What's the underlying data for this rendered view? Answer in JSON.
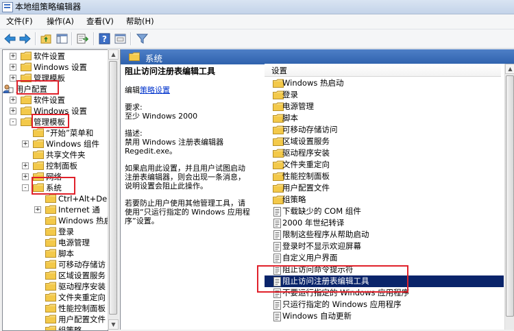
{
  "window": {
    "title": "本地组策略编辑器"
  },
  "menu": [
    {
      "label": "文件(F)"
    },
    {
      "label": "操作(A)"
    },
    {
      "label": "查看(V)"
    },
    {
      "label": "帮助(H)"
    }
  ],
  "toolbar": {
    "icons": [
      "back-arrow-icon",
      "forward-arrow-icon",
      "up-folder-icon",
      "show-hide-tree-icon",
      "export-list-icon",
      "help-icon",
      "properties-icon",
      "filter-icon"
    ]
  },
  "tree": {
    "items": [
      {
        "label": "软件设置",
        "expander": "+"
      },
      {
        "label": "Windows 设置",
        "expander": "+"
      },
      {
        "label": "管理模板",
        "expander": "+"
      },
      {
        "label": "用户配置",
        "expander": ""
      },
      {
        "label": "软件设置",
        "expander": "+"
      },
      {
        "label": "Windows 设置",
        "expander": "+"
      },
      {
        "label": "管理模板",
        "expander": "-"
      },
      {
        "label": "“开始”菜单和",
        "expander": ""
      },
      {
        "label": "Windows 组件",
        "expander": "+"
      },
      {
        "label": "共享文件夹",
        "expander": ""
      },
      {
        "label": "控制面板",
        "expander": "+"
      },
      {
        "label": "网络",
        "expander": "+"
      },
      {
        "label": "系统",
        "expander": "-"
      },
      {
        "label": "Ctrl+Alt+De",
        "expander": ""
      },
      {
        "label": "Internet 通",
        "expander": "+"
      },
      {
        "label": "Windows 热启",
        "expander": ""
      },
      {
        "label": "登录",
        "expander": ""
      },
      {
        "label": "电源管理",
        "expander": ""
      },
      {
        "label": "脚本",
        "expander": ""
      },
      {
        "label": "可移动存储访",
        "expander": ""
      },
      {
        "label": "区域设置服务",
        "expander": ""
      },
      {
        "label": "驱动程序安装",
        "expander": ""
      },
      {
        "label": "文件夹重定向",
        "expander": ""
      },
      {
        "label": "性能控制面板",
        "expander": ""
      },
      {
        "label": "用户配置文件",
        "expander": ""
      },
      {
        "label": "组策略",
        "expander": ""
      }
    ]
  },
  "right": {
    "header": "系统",
    "desc": {
      "title": "阻止访问注册表编辑工具",
      "edit_prefix": "编辑",
      "edit_link": "策略设置",
      "req_label": "要求:",
      "req_value": "至少 Windows 2000",
      "desc_label": "描述:",
      "desc_line1": "禁用 Windows 注册表编辑器",
      "desc_line2": "Regedit.exe。",
      "para1_l1": "如果启用此设置，并且用户试图启动",
      "para1_l2": "注册表编辑器，则会出现一条消息，",
      "para1_l3": "说明设置会阻止此操作。",
      "para2_l1": "若要防止用户使用其他管理工具，请",
      "para2_l2": "使用“只运行指定的 Windows 应用程",
      "para2_l3": "序”设置。"
    },
    "list_header": "设置",
    "list": [
      {
        "label": "Windows 热启动",
        "type": "folder"
      },
      {
        "label": "登录",
        "type": "folder"
      },
      {
        "label": "电源管理",
        "type": "folder"
      },
      {
        "label": "脚本",
        "type": "folder"
      },
      {
        "label": "可移动存储访问",
        "type": "folder"
      },
      {
        "label": "区域设置服务",
        "type": "folder"
      },
      {
        "label": "驱动程序安装",
        "type": "folder"
      },
      {
        "label": "文件夹重定向",
        "type": "folder"
      },
      {
        "label": "性能控制面板",
        "type": "folder"
      },
      {
        "label": "用户配置文件",
        "type": "folder"
      },
      {
        "label": "组策略",
        "type": "folder"
      },
      {
        "label": "下载缺少的 COM 组件",
        "type": "setting"
      },
      {
        "label": "2000 年世纪转译",
        "type": "setting"
      },
      {
        "label": "限制这些程序从帮助启动",
        "type": "setting"
      },
      {
        "label": "登录时不显示欢迎屏幕",
        "type": "setting"
      },
      {
        "label": "自定义用户界面",
        "type": "setting"
      },
      {
        "label": "阻止访问命令提示符",
        "type": "setting"
      },
      {
        "label": "阻止访问注册表编辑工具",
        "type": "setting",
        "selected": true
      },
      {
        "label": "不要运行指定的 Windows 应用程序",
        "type": "setting"
      },
      {
        "label": "只运行指定的 Windows 应用程序",
        "type": "setting"
      },
      {
        "label": "Windows 自动更新",
        "type": "setting"
      }
    ]
  }
}
